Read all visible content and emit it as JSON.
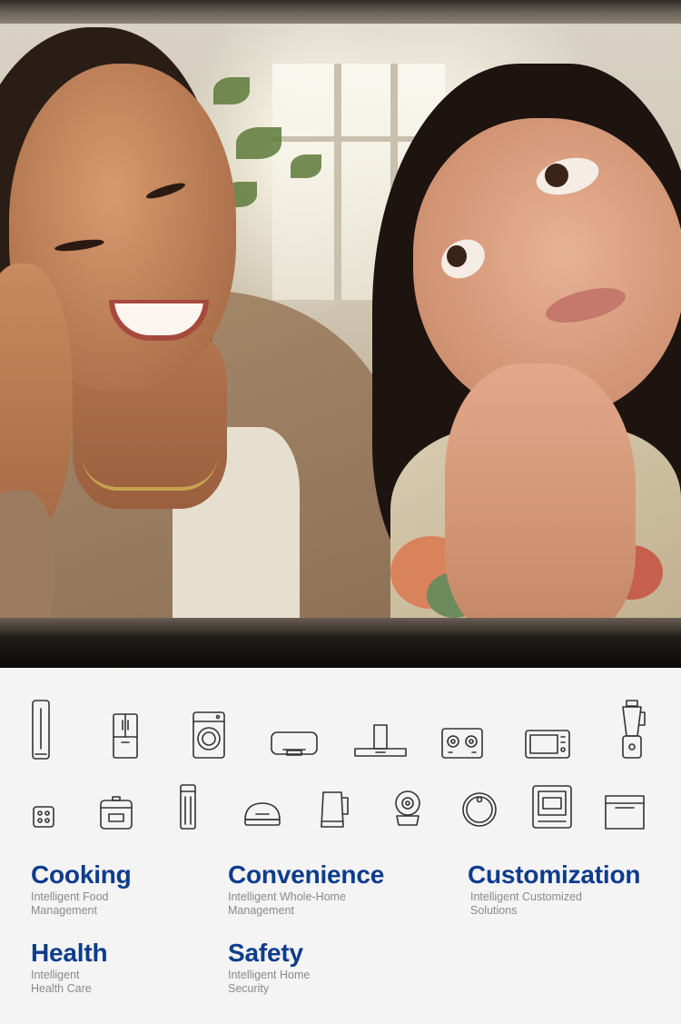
{
  "hero_image": {
    "alt": ""
  },
  "appliances": {
    "row1": [
      {
        "icon": "tower-fan-icon"
      },
      {
        "icon": "french-door-refrigerator-icon"
      },
      {
        "icon": "washing-machine-icon"
      },
      {
        "icon": "air-conditioner-icon"
      },
      {
        "icon": "range-hood-icon"
      },
      {
        "icon": "gas-stove-icon"
      },
      {
        "icon": "microwave-icon"
      },
      {
        "icon": "blender-icon"
      }
    ],
    "row2": [
      {
        "icon": "induction-cooktop-icon"
      },
      {
        "icon": "rice-cooker-icon"
      },
      {
        "icon": "air-purifier-icon"
      },
      {
        "icon": "humidifier-icon"
      },
      {
        "icon": "electric-kettle-icon"
      },
      {
        "icon": "security-camera-icon"
      },
      {
        "icon": "robot-vacuum-icon"
      },
      {
        "icon": "dishwasher-icon"
      },
      {
        "icon": "built-in-oven-icon"
      }
    ]
  },
  "features": [
    {
      "title": "Cooking",
      "line1": "Intelligent Food",
      "line2": "Management"
    },
    {
      "title": "Convenience",
      "line1": "Intelligent Whole-Home",
      "line2": "Management"
    },
    {
      "title": "Customization",
      "line1": "Intelligent Customized",
      "line2": "Solutions"
    },
    {
      "title": "Health",
      "line1": "Intelligent",
      "line2": "Health Care"
    },
    {
      "title": "Safety",
      "line1": "Intelligent Home",
      "line2": "Security"
    }
  ],
  "colors": {
    "feature_title": "#0d3c8d",
    "feature_subtitle": "#8a8a8a",
    "background": "#f4f4f4"
  }
}
